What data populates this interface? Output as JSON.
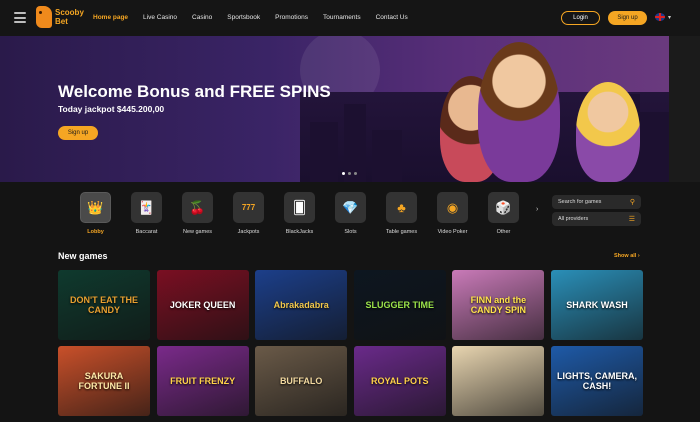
{
  "header": {
    "logo_line1": "Scooby",
    "logo_line2": "Bet",
    "nav": [
      "Home page",
      "Live Casino",
      "Casino",
      "Sportsbook",
      "Promotions",
      "Tournaments",
      "Contact Us"
    ],
    "login_label": "Login",
    "signup_label": "Sign up"
  },
  "hero": {
    "title": "Welcome Bonus and FREE SPINS",
    "subtitle": "Today jackpot $445.200,00",
    "cta_label": "Sign up"
  },
  "categories": [
    "Lobby",
    "Baccarat",
    "New games",
    "Jackpots",
    "BlackJacks",
    "Slots",
    "Table games",
    "Video Poker",
    "Other"
  ],
  "search": {
    "placeholder": "Search for games"
  },
  "providers": {
    "label": "All providers"
  },
  "section": {
    "title": "New games",
    "show_all": "Show all ›"
  },
  "games": [
    {
      "title": "DON'T EAT THE CANDY",
      "bg": "#0f3a2e",
      "fg": "#e8a030"
    },
    {
      "title": "JOKER QUEEN",
      "bg": "#7a0f22",
      "fg": "#ffffff"
    },
    {
      "title": "Abrakadabra",
      "bg": "#1c3f8a",
      "fg": "#f2c84b"
    },
    {
      "title": "SLUGGER TIME",
      "bg": "#0d1620",
      "fg": "#9be34a"
    },
    {
      "title": "FINN and the CANDY SPIN",
      "bg": "#c97ab8",
      "fg": "#ffe24a"
    },
    {
      "title": "SHARK WASH",
      "bg": "#2a8fb8",
      "fg": "#ffffff"
    },
    {
      "title": "SAKURA FORTUNE II",
      "bg": "#c9502a",
      "fg": "#ffe9a8"
    },
    {
      "title": "FRUIT FRENZY",
      "bg": "#7a2a8a",
      "fg": "#ffd24a"
    },
    {
      "title": "BUFFALO",
      "bg": "#6a5a48",
      "fg": "#f2d9a0"
    },
    {
      "title": "ROYAL POTS",
      "bg": "#6a2a8a",
      "fg": "#ffd24a"
    },
    {
      "title": "",
      "bg": "#e8d5b0",
      "fg": "#7a4a1a"
    },
    {
      "title": "LIGHTS, CAMERA, CASH!",
      "bg": "#1e5aa8",
      "fg": "#ffffff"
    }
  ]
}
